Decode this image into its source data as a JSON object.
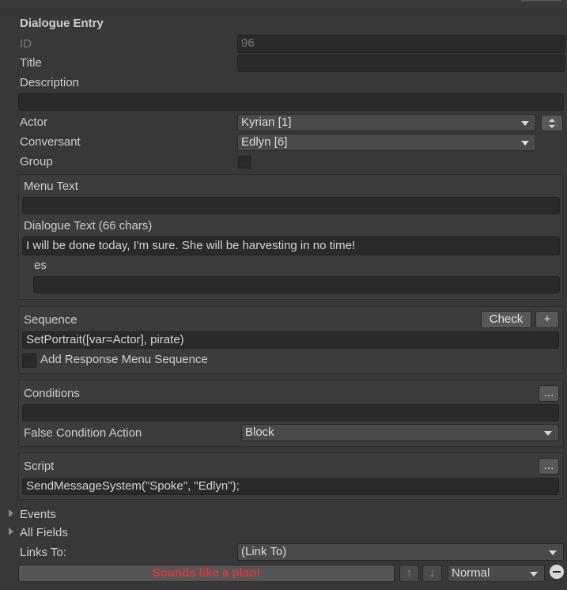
{
  "entry": {
    "header": "Dialogue Entry",
    "id_label": "ID",
    "id_value": "96",
    "title_label": "Title",
    "title_value": "",
    "description_label": "Description",
    "description_value": "",
    "actor_label": "Actor",
    "actor_value": "Kyrian [1]",
    "conversant_label": "Conversant",
    "conversant_value": "Edlyn [6]",
    "group_label": "Group",
    "group_checked": false
  },
  "text_panel": {
    "menu_text_label": "Menu Text",
    "menu_text_value": "",
    "dialogue_text_label": "Dialogue Text (66 chars)",
    "dialogue_text_value": "I will be done today, I'm sure. She will be harvesting in no time!",
    "localization_label": "es",
    "localization_value": ""
  },
  "sequence_panel": {
    "label": "Sequence",
    "check_button": "Check",
    "add_button": "+",
    "value": "SetPortrait([var=Actor], pirate)",
    "response_menu_label": "Add Response Menu Sequence",
    "response_menu_checked": false
  },
  "conditions_panel": {
    "label": "Conditions",
    "more_button": "...",
    "value": "",
    "false_action_label": "False Condition Action",
    "false_action_value": "Block"
  },
  "script_panel": {
    "label": "Script",
    "more_button": "...",
    "value": "SendMessageSystem(\"Spoke\", \"Edlyn\");"
  },
  "foldouts": {
    "events": "Events",
    "all_fields": "All Fields"
  },
  "links": {
    "label": "Links To:",
    "dropdown_value": "(Link To)",
    "link_item_text": "Sounds like a plan!",
    "up_arrow": "↑",
    "down_arrow": "↓",
    "priority_value": "Normal",
    "remove_icon": "minus-circle-icon"
  },
  "colors": {
    "background": "#383838",
    "field": "#2a2a2a",
    "link_text": "#d83a3a"
  }
}
